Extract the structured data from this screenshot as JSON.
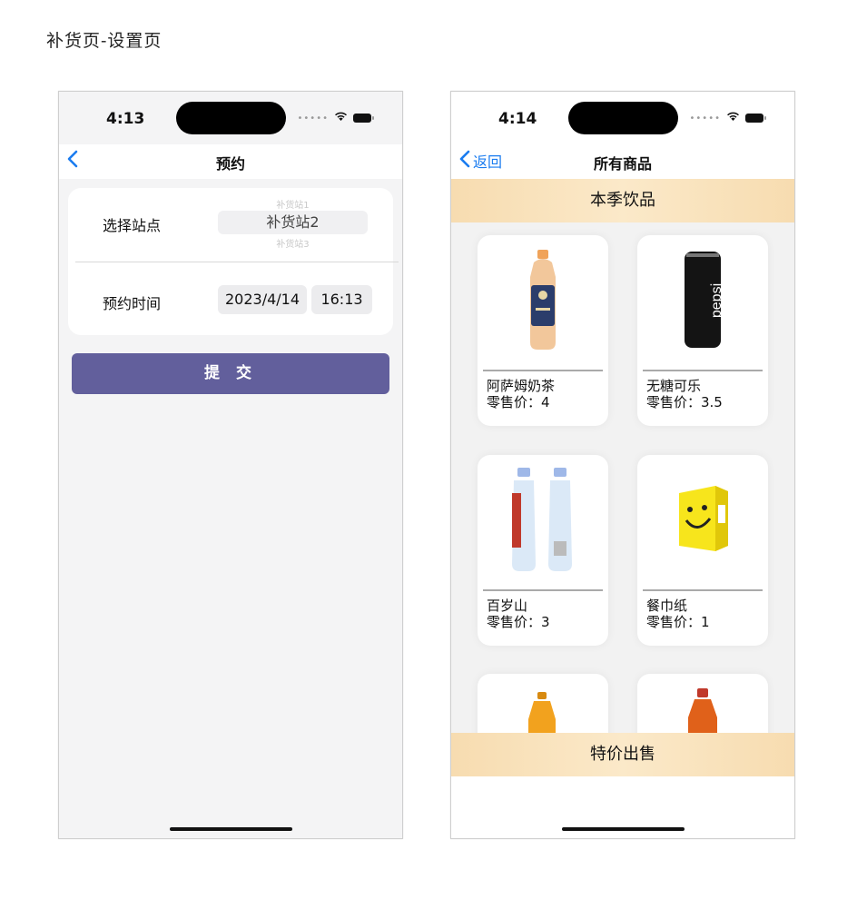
{
  "page_title": "补货页-设置页",
  "phone1": {
    "status_time": "4:13",
    "nav_title": "预约",
    "form": {
      "station_label": "选择站点",
      "station_prev": "补货站1",
      "station_value": "补货站2",
      "station_next": "补货站3",
      "time_label": "预约时间",
      "date_value": "2023/4/14",
      "time_value": "16:13"
    },
    "submit_label": "提 交"
  },
  "phone2": {
    "status_time": "4:14",
    "back_label": "返回",
    "nav_title": "所有商品",
    "section1_title": "本季饮品",
    "section2_title": "特价出售",
    "products": [
      {
        "name": "阿萨姆奶茶",
        "price": "零售价：4"
      },
      {
        "name": "无糖可乐",
        "price": "零售价：3.5"
      },
      {
        "name": "百岁山",
        "price": "零售价：3"
      },
      {
        "name": "餐巾纸",
        "price": "零售价：1"
      }
    ],
    "pepsi_text": "pepsi"
  },
  "colors": {
    "accent_blue": "#1a7cf0",
    "submit_purple": "#625f9c",
    "section_gold": "#f7dcb0"
  }
}
